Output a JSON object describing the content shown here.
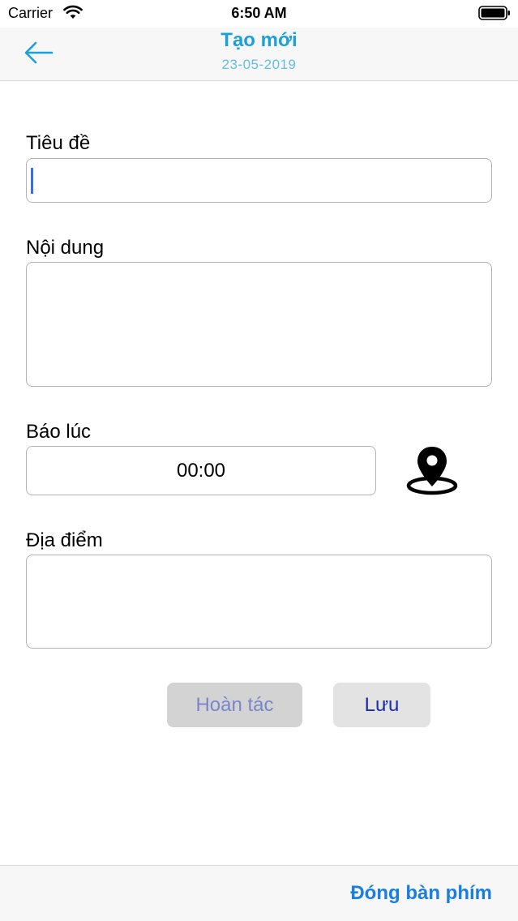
{
  "status_bar": {
    "carrier": "Carrier",
    "time": "6:50 AM"
  },
  "nav": {
    "title": "Tạo mới",
    "subtitle": "23-05-2019",
    "back_icon": "arrow-left-icon",
    "accent_color": "#1ba0d8"
  },
  "form": {
    "title_label": "Tiêu đề",
    "title_value": "",
    "content_label": "Nội dung",
    "content_value": "",
    "alarm_label": "Báo lúc",
    "alarm_time": "00:00",
    "location_icon": "map-pin-icon",
    "location_label": "Địa điểm",
    "location_value": ""
  },
  "actions": {
    "undo_label": "Hoàn tác",
    "save_label": "Lưu"
  },
  "bottom_bar": {
    "dismiss_keyboard_label": "Đóng bàn phím",
    "link_color": "#1a7ee0"
  }
}
